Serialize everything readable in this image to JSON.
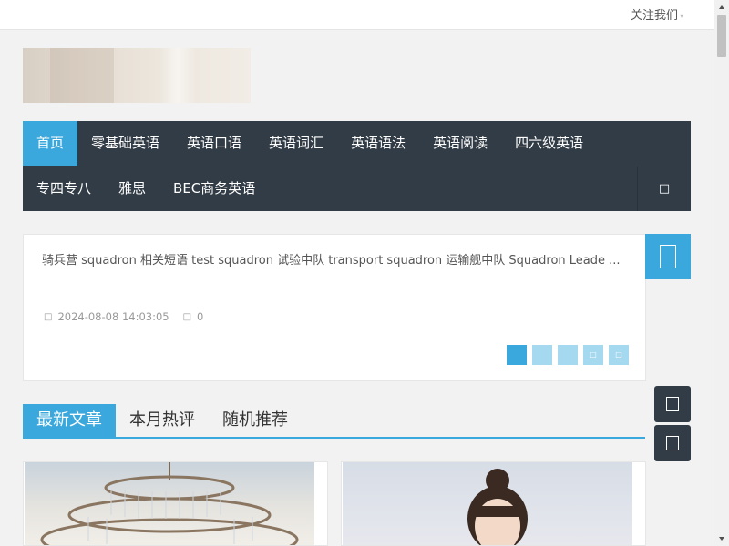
{
  "topbar": {
    "follow_label": "关注我们",
    "caret": "▾"
  },
  "nav": {
    "row1": [
      "首页",
      "零基础英语",
      "英语口语",
      "英语词汇",
      "英语语法",
      "英语阅读",
      "四六级英语"
    ],
    "row2": [
      "专四专八",
      "雅思",
      "BEC商务英语"
    ],
    "active_index": 0,
    "search_icon": "□"
  },
  "slider": {
    "text": "骑兵营   squadron 相关短语   test squadron 试验中队 transport squadron 运输舰中队 Squadron Leade ...",
    "date": "2024-08-08 14:03:05",
    "comments": "0",
    "clock_icon": "□",
    "comment_icon": "□",
    "dots": [
      "",
      "",
      "",
      "□",
      "□"
    ],
    "active_dot": 0
  },
  "tabs": [
    "最新文章",
    "本月热评",
    "随机推荐"
  ],
  "colors": {
    "accent": "#3aa8dc",
    "nav_bg": "#323c46",
    "page_bg": "#f2f2f2"
  }
}
